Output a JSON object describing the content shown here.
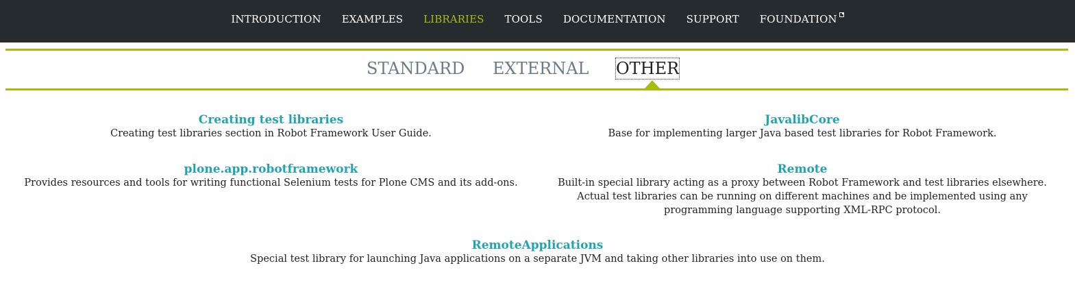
{
  "topnav": {
    "items": [
      {
        "label": "INTRODUCTION"
      },
      {
        "label": "EXAMPLES"
      },
      {
        "label": "LIBRARIES",
        "active": true
      },
      {
        "label": "TOOLS"
      },
      {
        "label": "DOCUMENTATION"
      },
      {
        "label": "SUPPORT"
      },
      {
        "label": "FOUNDATION",
        "external": true
      }
    ]
  },
  "subtabs": {
    "items": [
      {
        "label": "STANDARD"
      },
      {
        "label": "EXTERNAL"
      },
      {
        "label": "OTHER",
        "active": true
      }
    ]
  },
  "libraries": [
    {
      "title": "Creating test libraries",
      "description": "Creating test libraries section in Robot Framework User Guide."
    },
    {
      "title": "JavalibCore",
      "description": "Base for implementing larger Java based test libraries for Robot Framework."
    },
    {
      "title": "plone.app.robotframework",
      "description": "Provides resources and tools for writing functional Selenium tests for Plone CMS and its add-ons."
    },
    {
      "title": "Remote",
      "description": "Built-in special library acting as a proxy between Robot Framework and test libraries elsewhere. Actual test libraries can be running on different machines and be implemented using any programming language supporting XML-RPC protocol."
    },
    {
      "title": "RemoteApplications",
      "description": "Special test library for launching Java applications on a separate JVM and taking other libraries into use on them."
    }
  ],
  "colors": {
    "nav_bg": "#262b2f",
    "accent": "#a4bd0f",
    "link": "#21a3b0",
    "inactive_tab": "#6e7b87"
  }
}
